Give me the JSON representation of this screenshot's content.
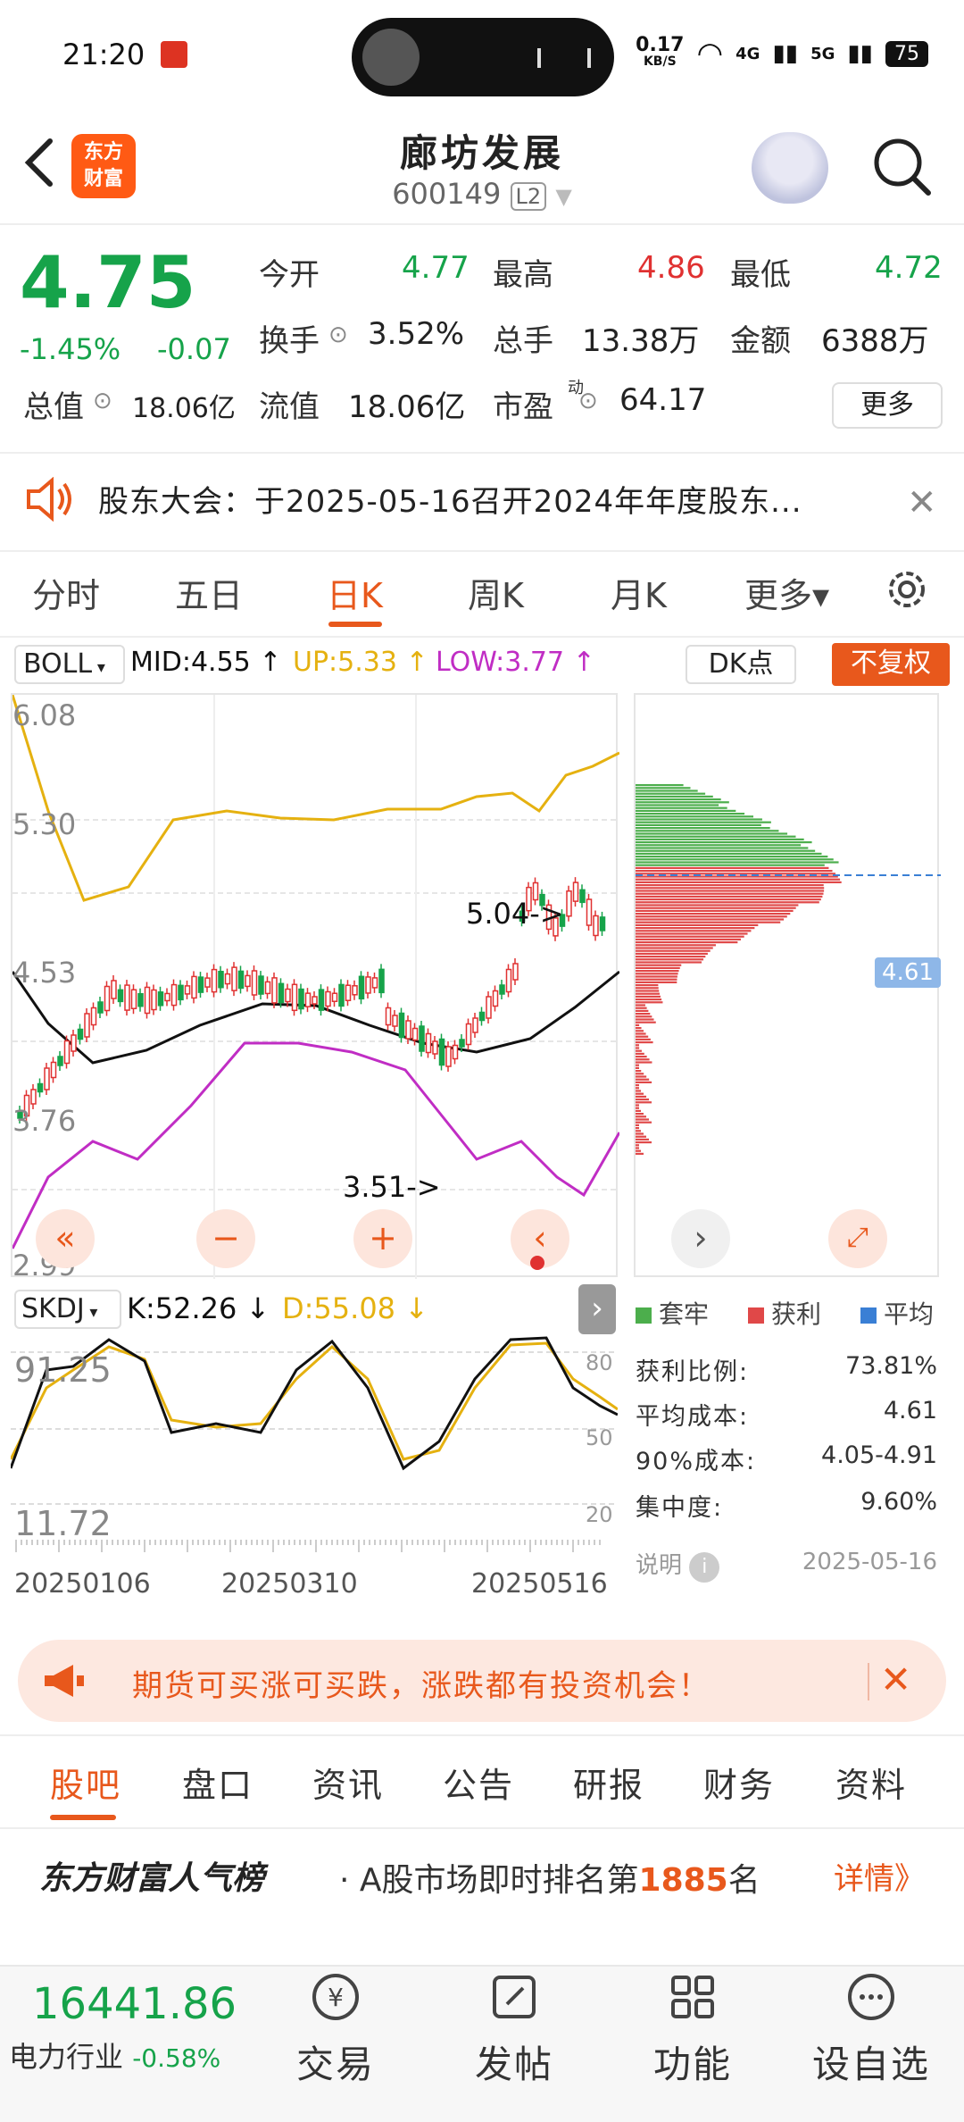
{
  "status_bar": {
    "time": "21:20",
    "net_speed_top": "0.17",
    "net_speed_bottom": "KB/S",
    "net1": "4G",
    "net2": "5G",
    "battery": "75"
  },
  "header": {
    "title": "廊坊发展",
    "code": "600149",
    "level": "L2",
    "logo_line1": "东方",
    "logo_line2": "财富"
  },
  "quote": {
    "price": "4.75",
    "change_pct": "-1.45%",
    "change": "-0.07",
    "open_label": "今开",
    "open": "4.77",
    "high_label": "最高",
    "high": "4.86",
    "low_label": "最低",
    "low": "4.72",
    "turnover_label": "换手",
    "turnover": "3.52%",
    "volume_label": "总手",
    "volume": "13.38万",
    "amount_label": "金额",
    "amount": "6388万",
    "mktcap_label": "总值",
    "mktcap": "18.06亿",
    "float_label": "流值",
    "float": "18.06亿",
    "pe_label": "市盈",
    "pe_sup": "动",
    "pe": "64.17",
    "more": "更多"
  },
  "notice": {
    "text": "股东大会：于2025-05-16召开2024年年度股东..."
  },
  "tabs": [
    "分时",
    "五日",
    "日K",
    "周K",
    "月K",
    "更多▾"
  ],
  "active_tab": 2,
  "indicators": {
    "boll": "BOLL",
    "mid": "MID:4.55 ↑",
    "up": "UP:5.33 ↑",
    "low": "LOW:3.77 ↑",
    "dk": "DK点",
    "fq": "不复权",
    "skdj": "SKDJ",
    "k": "K:52.26 ↓",
    "d": "D:55.08 ↓"
  },
  "main_chart": {
    "yticks": [
      "6.08",
      "5.30",
      "4.53",
      "3.76",
      "2.99"
    ],
    "high_annot": "5.04->",
    "low_annot": "3.51->",
    "sub_yticks": [
      "91.25",
      "11.72"
    ],
    "sub_grid": [
      "80",
      "50",
      "20"
    ],
    "dates": [
      "20250106",
      "20250310",
      "20250516"
    ]
  },
  "chip": {
    "avg_tag": "4.61",
    "legend": [
      "套牢",
      "获利",
      "平均"
    ],
    "legend_colors": [
      "#4cae4c",
      "#e04848",
      "#3a7fd5"
    ],
    "stats": [
      {
        "label": "获利比例:",
        "value": "73.81%"
      },
      {
        "label": "平均成本:",
        "value": "4.61"
      },
      {
        "label": "90%成本:",
        "value": "4.05-4.91"
      },
      {
        "label": "集中度:",
        "value": "9.60%"
      }
    ],
    "explain": "说明",
    "date": "2025-05-16"
  },
  "ad": {
    "text": "期货可买涨可买跌，涨跌都有投资机会！"
  },
  "bottom_tabs": [
    "股吧",
    "盘口",
    "资讯",
    "公告",
    "研报",
    "财务",
    "资料"
  ],
  "rank": {
    "brand": "东方财富人气榜",
    "text_pre": "· A股市场即时排名第",
    "num": "1885",
    "text_post": "名",
    "more": "详情》"
  },
  "bottom_bar": {
    "index_value": "16441.86",
    "index_name": "电力行业",
    "index_pct": "-0.58%",
    "items": [
      "交易",
      "发帖",
      "功能",
      "设自选"
    ]
  },
  "colors": {
    "accent": "#e8581c",
    "down": "#16a34a",
    "up": "#e03131",
    "upper_band": "#e5b110",
    "lower_band": "#c02dc4"
  }
}
